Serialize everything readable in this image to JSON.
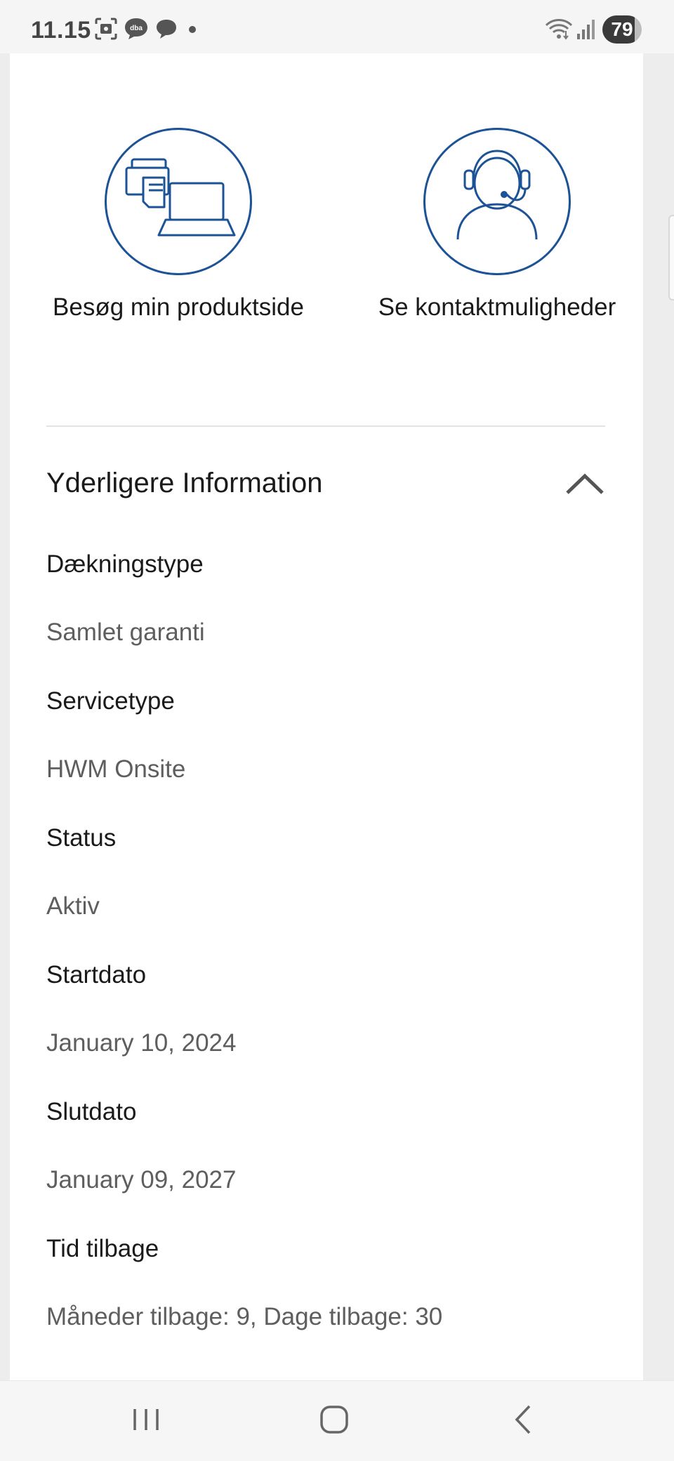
{
  "status_bar": {
    "time": "11.15",
    "battery": "79",
    "icons": [
      "screenshot-icon",
      "dba-chat-icon",
      "message-icon",
      "dot-icon",
      "wifi-icon",
      "signal-icon"
    ],
    "dba_text": "dba"
  },
  "quick_links": [
    {
      "label": "Besøg min produktside",
      "icon": "devices-icon"
    },
    {
      "label": "Se kontaktmuligheder",
      "icon": "support-agent-icon"
    }
  ],
  "section": {
    "title": "Yderligere Information",
    "expanded": true
  },
  "info": [
    {
      "label": "Dækningstype",
      "value": "Samlet garanti"
    },
    {
      "label": "Servicetype",
      "value": "HWM Onsite"
    },
    {
      "label": "Status",
      "value": "Aktiv"
    },
    {
      "label": "Startdato",
      "value": "January 10, 2024"
    },
    {
      "label": "Slutdato",
      "value": "January 09, 2027"
    },
    {
      "label": "Tid tilbage",
      "value": "Måneder tilbage: 9, Dage tilbage: 30"
    }
  ],
  "colors": {
    "accent": "#1c5396",
    "background": "#ededed",
    "card": "#ffffff"
  },
  "nav": [
    "recent-apps-icon",
    "home-icon",
    "back-icon"
  ]
}
